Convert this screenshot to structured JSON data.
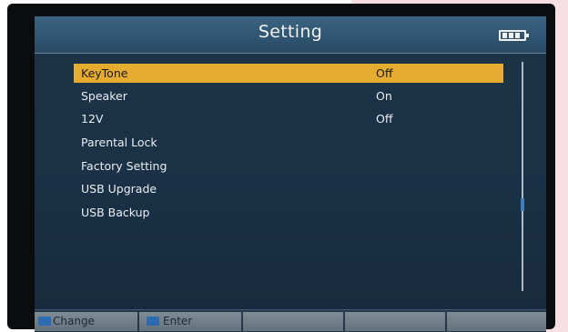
{
  "screen": {
    "title": "Setting"
  },
  "menu": {
    "items": [
      {
        "label": "KeyTone",
        "value": "Off"
      },
      {
        "label": "Speaker",
        "value": "On"
      },
      {
        "label": "12V",
        "value": "Off"
      },
      {
        "label": "Parental Lock",
        "value": ""
      },
      {
        "label": "Factory Setting",
        "value": ""
      },
      {
        "label": "USB Upgrade",
        "value": ""
      },
      {
        "label": "USB Backup",
        "value": ""
      }
    ],
    "selected_index": 0
  },
  "footer": {
    "change_label": "Change",
    "enter_label": "Enter"
  },
  "status": {
    "battery_icon": "battery-icon"
  },
  "colors": {
    "highlight": "#e6ac2f",
    "title_bar": "#2f5470",
    "background": "#1a3146",
    "footer_segment": "#707c86",
    "key_icon": "#2b6cb0"
  }
}
